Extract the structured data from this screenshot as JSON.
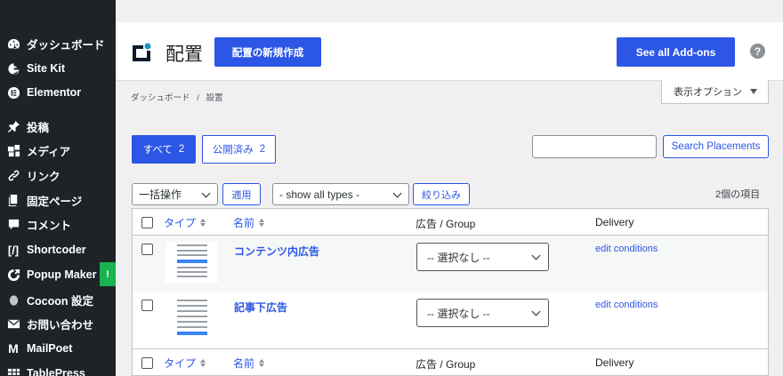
{
  "sidebar": {
    "items": [
      {
        "label": "ダッシュボード",
        "icon": "dashboard-icon"
      },
      {
        "label": "Site Kit",
        "icon": "site-kit-icon"
      },
      {
        "label": "Elementor",
        "icon": "elementor-icon"
      },
      {
        "label": "投稿",
        "icon": "pin-icon"
      },
      {
        "label": "メディア",
        "icon": "media-icon"
      },
      {
        "label": "リンク",
        "icon": "link-icon"
      },
      {
        "label": "固定ページ",
        "icon": "page-icon"
      },
      {
        "label": "コメント",
        "icon": "comment-icon"
      },
      {
        "label": "Shortcoder",
        "icon": "shortcoder-icon"
      },
      {
        "label": "Popup Maker",
        "icon": "popup-maker-icon",
        "badge": "!"
      },
      {
        "label": "Cocoon 設定",
        "icon": "cocoon-icon"
      },
      {
        "label": "お問い合わせ",
        "icon": "mail-icon"
      },
      {
        "label": "MailPoet",
        "icon": "mailpoet-icon"
      },
      {
        "label": "TablePress",
        "icon": "tablepress-icon"
      }
    ]
  },
  "header": {
    "title": "配置",
    "new_button": "配置の新規作成",
    "addons_button": "See all Add-ons",
    "help": "?"
  },
  "breadcrumb": {
    "parent": "ダッシュボード",
    "separator": "/",
    "current": "設置"
  },
  "screen_options": "表示オプション",
  "filters": {
    "all_label": "すべて",
    "all_count": "2",
    "published_label": "公開済み",
    "published_count": "2",
    "search_value": "",
    "search_button": "Search Placements"
  },
  "bulk": {
    "action_select": "一括操作",
    "apply_button": "適用",
    "type_select": "- show all types -",
    "filter_button": "絞り込み",
    "items_count": "2個の項目"
  },
  "table": {
    "columns": {
      "type": "タイプ",
      "name": "名前",
      "ad_group": "広告 / Group",
      "delivery": "Delivery"
    },
    "rows": [
      {
        "name": "コンテンツ内広告",
        "ad_select": "-- 選択なし --",
        "delivery_link": "edit conditions"
      },
      {
        "name": "記事下広告",
        "ad_select": "-- 選択なし --",
        "delivery_link": "edit conditions"
      }
    ]
  },
  "colors": {
    "accent": "#2c56e5",
    "sidebar_bg": "#1d2327",
    "badge": "#19b34f"
  }
}
